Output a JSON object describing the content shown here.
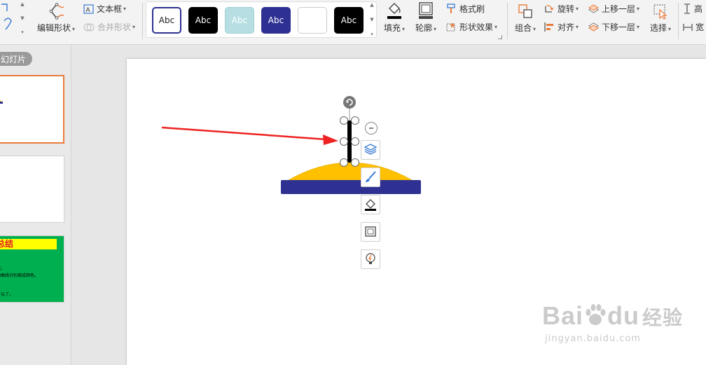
{
  "ribbon": {
    "edit_shape": "编辑形状",
    "text_box": "文本框",
    "merge_shape": "合并形状",
    "styles": [
      {
        "label": "Abc",
        "bg": "#ffffff",
        "fg": "#222222",
        "border": "#2e3192"
      },
      {
        "label": "Abc",
        "bg": "#000000",
        "fg": "#ffffff",
        "border": "#000000"
      },
      {
        "label": "Abc",
        "bg": "#b7dfe3",
        "fg": "#ffffff",
        "border": "#9fcfd4"
      },
      {
        "label": "Abc",
        "bg": "#2e3192",
        "fg": "#ffffff",
        "border": "#2e3192"
      },
      {
        "label": "",
        "bg": "#ffffff",
        "fg": "#222222",
        "border": "#cccccc"
      },
      {
        "label": "Abc",
        "bg": "#000000",
        "fg": "#ffffff",
        "border": "#000000"
      }
    ],
    "fill": "填充",
    "outline": "轮廓",
    "format_painter": "格式刷",
    "shape_effects": "形状效果",
    "group": "组合",
    "rotate": "旋转",
    "align": "对齐",
    "bring_forward": "上移一层",
    "send_backward": "下移一层",
    "select": "选择",
    "height_short": "高",
    "width_short": "宽"
  },
  "panel": {
    "tab_label": "幻灯片",
    "thumb3_title": "总结",
    "thumb3_lines": [
      "状。",
      "的曲线分别填成颜色。",
      "。",
      "可以了。"
    ]
  },
  "watermark": {
    "brand": "Bai",
    "brand2": "du",
    "brand_cn": "经验",
    "url": "jingyan.baidu.com"
  },
  "colors": {
    "accent_orange": "#e97b3b",
    "hat_yellow": "#ffc000",
    "brim_blue": "#2e3192",
    "arrow_red": "#ee2222",
    "thumb3_green": "#00b050"
  }
}
